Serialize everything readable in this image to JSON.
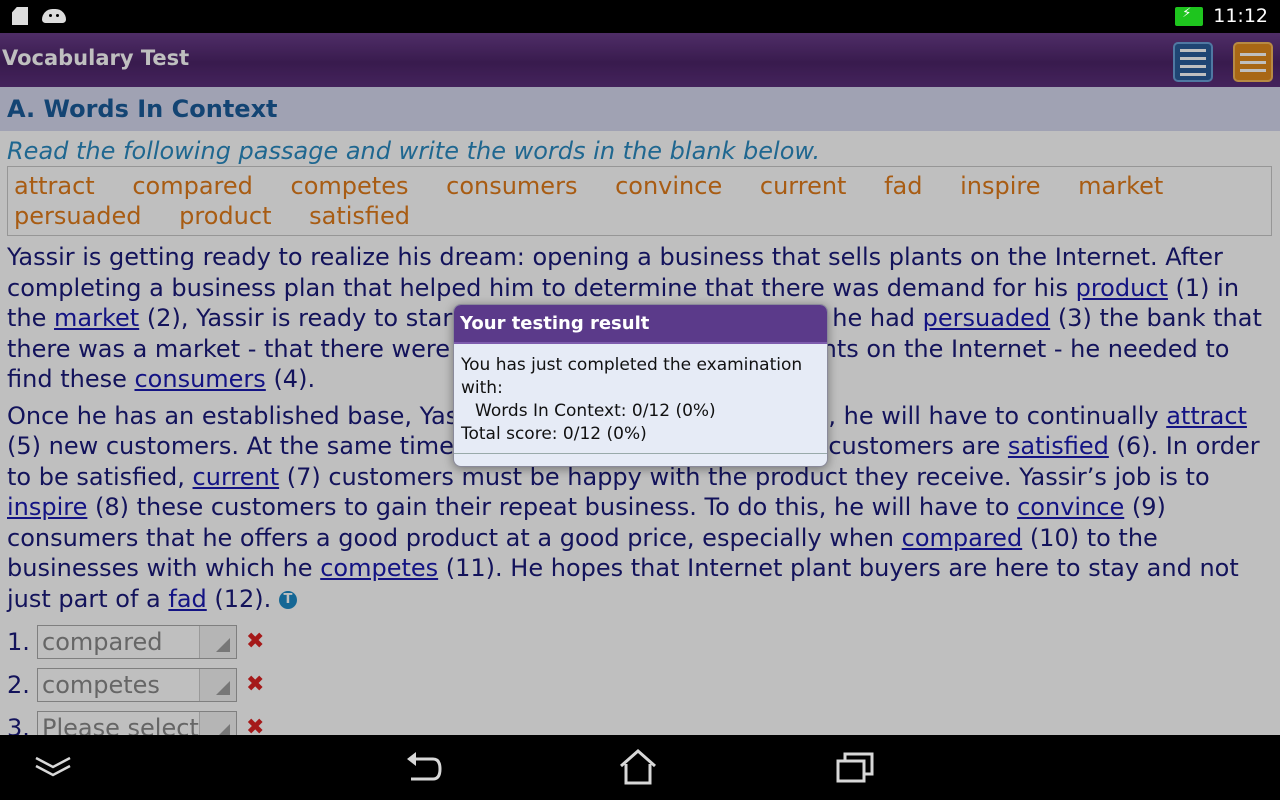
{
  "status_bar": {
    "time": "11:12"
  },
  "app_bar": {
    "title": "Vocabulary Test"
  },
  "section": {
    "title": "A. Words In Context",
    "instruction": "Read the following passage and write the words in the blank below."
  },
  "word_bank": [
    "attract",
    "compared",
    "competes",
    "consumers",
    "convince",
    "current",
    "fad",
    "inspire",
    "market",
    "persuaded",
    "product",
    "satisfied"
  ],
  "passage": {
    "p1": [
      "Yassir is getting ready to realize his dream: opening a business that sells plants on the Internet. After completing a business plan that helped him to determine that there was demand for his ",
      "product",
      " (1) in the ",
      "market",
      " (2), Yassir is ready to start promoting his business. Once he had ",
      "persuaded",
      " (3) the bank that there was a market - that there were consumers who would buy plants on the Internet - he needed to find these ",
      "consumers",
      " (4)."
    ],
    "p2": [
      "Once he has an established base, Yassir knows that to be successful, he will have to continually ",
      "attract",
      " (5) new customers. At the same time, he will need to make sure his customers are ",
      "satisfied",
      " (6). In order to be satisfied, ",
      "current",
      " (7) customers must be happy with the product they receive. Yassir’s job is to ",
      "inspire",
      " (8) these customers to gain their repeat business. To do this, he will have to ",
      "convince",
      " (9) consumers that he offers a good product at a good price, especially when ",
      "compared",
      " (10) to the businesses with which he ",
      "competes",
      " (11). He hopes that Internet plant buyers are here to stay and not just part of a ",
      "fad",
      " (12). "
    ]
  },
  "answers": [
    {
      "num": "1.",
      "value": "compared",
      "mark": "✖"
    },
    {
      "num": "2.",
      "value": "competes",
      "mark": "✖"
    },
    {
      "num": "3.",
      "value": "Please select",
      "mark": "✖"
    }
  ],
  "dialog": {
    "title": "Your testing result",
    "line1": "You has just completed the examination with:",
    "line2": "Words In Context: 0/12 (0%)",
    "line3": "Total score: 0/12 (0%)"
  },
  "icons": {
    "t_badge": "T",
    "nav": [
      "keyboard-hide-icon",
      "back-icon",
      "home-icon",
      "recents-icon"
    ]
  },
  "colors": {
    "appbar": "#5b2f7b",
    "dialog_title": "#5b3a8a",
    "word_bank": "#e07b1a"
  }
}
